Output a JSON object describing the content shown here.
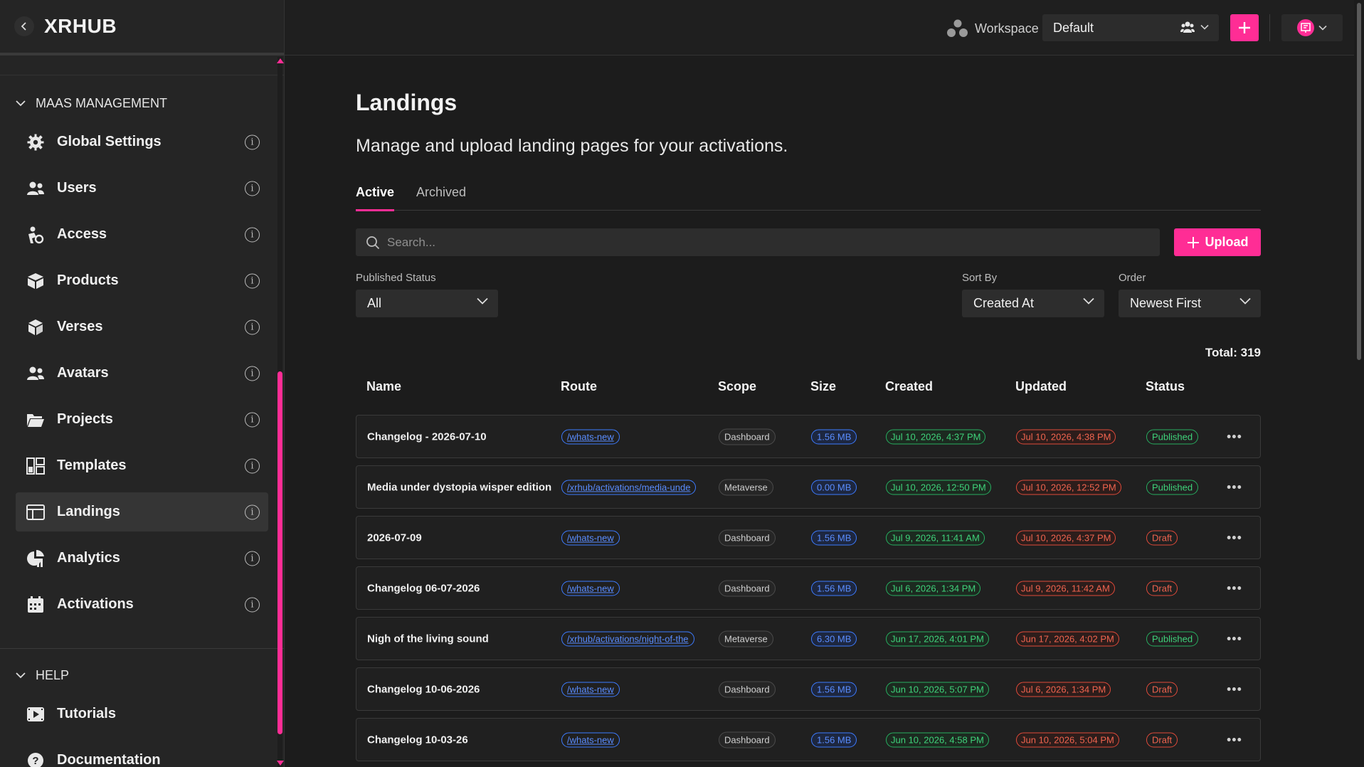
{
  "brand": "XRHUB",
  "sidebar": {
    "section_main": "MAAS MANAGEMENT",
    "items": [
      {
        "label": "Global Settings",
        "icon": "gear-icon"
      },
      {
        "label": "Users",
        "icon": "users-icon"
      },
      {
        "label": "Access",
        "icon": "access-icon"
      },
      {
        "label": "Products",
        "icon": "box-icon"
      },
      {
        "label": "Verses",
        "icon": "cube-icon"
      },
      {
        "label": "Avatars",
        "icon": "avatars-icon"
      },
      {
        "label": "Projects",
        "icon": "folder-icon"
      },
      {
        "label": "Templates",
        "icon": "templates-icon"
      },
      {
        "label": "Landings",
        "icon": "landing-icon",
        "active": true
      },
      {
        "label": "Analytics",
        "icon": "analytics-icon"
      },
      {
        "label": "Activations",
        "icon": "calendar-icon"
      }
    ],
    "section_help": "HELP",
    "help_items": [
      {
        "label": "Tutorials",
        "icon": "video-icon"
      },
      {
        "label": "Documentation",
        "icon": "question-icon"
      }
    ]
  },
  "topbar": {
    "workspace_label": "Workspace",
    "workspace_value": "Default"
  },
  "page": {
    "title": "Landings",
    "subtitle": "Manage and upload landing pages for your activations."
  },
  "tabs": [
    {
      "label": "Active",
      "active": true
    },
    {
      "label": "Archived",
      "active": false
    }
  ],
  "search": {
    "placeholder": "Search..."
  },
  "upload_label": "Upload",
  "filters": {
    "published_status": {
      "label": "Published Status",
      "value": "All"
    },
    "sort_by": {
      "label": "Sort By",
      "value": "Created At"
    },
    "order": {
      "label": "Order",
      "value": "Newest First"
    }
  },
  "total": "Total: 319",
  "columns": [
    "Name",
    "Route",
    "Scope",
    "Size",
    "Created",
    "Updated",
    "Status"
  ],
  "rows": [
    {
      "name": "Changelog - 2026-07-10",
      "route": "/whats-new",
      "scope": "Dashboard",
      "size": "1.56 MB",
      "created": "Jul 10, 2026, 4:37 PM",
      "updated": "Jul 10, 2026, 4:38 PM",
      "status": "Published"
    },
    {
      "name": "Media under dystopia wisper edition",
      "route": "/xrhub/activations/media-unde",
      "scope": "Metaverse",
      "size": "0.00 MB",
      "created": "Jul 10, 2026, 12:50 PM",
      "updated": "Jul 10, 2026, 12:52 PM",
      "status": "Published"
    },
    {
      "name": "2026-07-09",
      "route": "/whats-new",
      "scope": "Dashboard",
      "size": "1.56 MB",
      "created": "Jul 9, 2026, 11:41 AM",
      "updated": "Jul 10, 2026, 4:37 PM",
      "status": "Draft"
    },
    {
      "name": "Changelog 06-07-2026",
      "route": "/whats-new",
      "scope": "Dashboard",
      "size": "1.56 MB",
      "created": "Jul 6, 2026, 1:34 PM",
      "updated": "Jul 9, 2026, 11:42 AM",
      "status": "Draft"
    },
    {
      "name": "Nigh of the living sound",
      "route": "/xrhub/activations/night-of-the",
      "scope": "Metaverse",
      "size": "6.30 MB",
      "created": "Jun 17, 2026, 4:01 PM",
      "updated": "Jun 17, 2026, 4:02 PM",
      "status": "Published"
    },
    {
      "name": "Changelog 10-06-2026",
      "route": "/whats-new",
      "scope": "Dashboard",
      "size": "1.56 MB",
      "created": "Jun 10, 2026, 5:07 PM",
      "updated": "Jul 6, 2026, 1:34 PM",
      "status": "Draft"
    },
    {
      "name": "Changelog 10-03-26",
      "route": "/whats-new",
      "scope": "Dashboard",
      "size": "1.56 MB",
      "created": "Jun 10, 2026, 4:58 PM",
      "updated": "Jun 10, 2026, 5:04 PM",
      "status": "Draft"
    }
  ],
  "colors": {
    "accent": "#ff2d95",
    "link": "#3d7bff",
    "success": "#27ae60",
    "danger": "#e04a3a"
  }
}
